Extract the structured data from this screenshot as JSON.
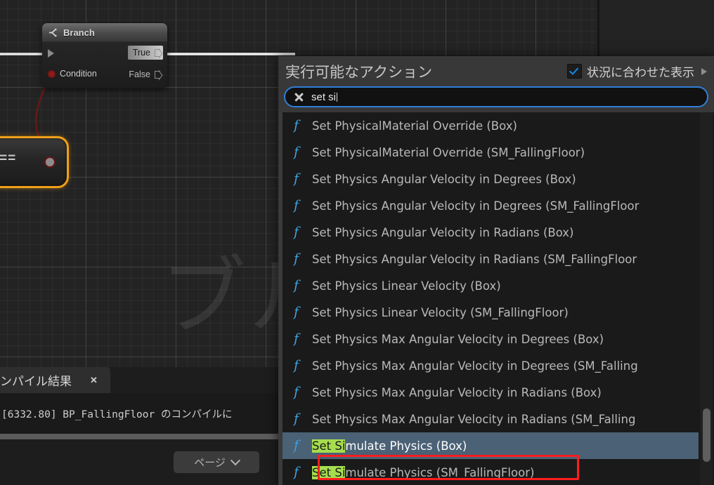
{
  "graph": {
    "watermark": "ブル",
    "branch_node": {
      "title": "Branch",
      "icon": "branch-icon",
      "exec_in": "",
      "condition_label": "Condition",
      "true_label": "True",
      "false_label": "False"
    },
    "equals_node": {
      "label": "==",
      "selected": true
    }
  },
  "actions_menu": {
    "title": "実行可能なアクション",
    "context_checkbox": {
      "label": "状況に合わせた表示",
      "checked": true
    },
    "search": {
      "value": "set si",
      "clear_icon": "close-icon"
    },
    "items": [
      {
        "icon": "function-icon",
        "prefix": "",
        "highlight": "",
        "suffix": "Set PhysicalMaterial Override (Box)",
        "selected": false,
        "annotated": false
      },
      {
        "icon": "function-icon",
        "prefix": "",
        "highlight": "",
        "suffix": "Set PhysicalMaterial Override (SM_FallingFloor)",
        "selected": false,
        "annotated": false
      },
      {
        "icon": "function-icon",
        "prefix": "",
        "highlight": "",
        "suffix": "Set Physics Angular Velocity in Degrees (Box)",
        "selected": false,
        "annotated": false
      },
      {
        "icon": "function-icon",
        "prefix": "",
        "highlight": "",
        "suffix": "Set Physics Angular Velocity in Degrees (SM_FallingFloor",
        "selected": false,
        "annotated": false
      },
      {
        "icon": "function-icon",
        "prefix": "",
        "highlight": "",
        "suffix": "Set Physics Angular Velocity in Radians (Box)",
        "selected": false,
        "annotated": false
      },
      {
        "icon": "function-icon",
        "prefix": "",
        "highlight": "",
        "suffix": "Set Physics Angular Velocity in Radians (SM_FallingFloor",
        "selected": false,
        "annotated": false
      },
      {
        "icon": "function-icon",
        "prefix": "",
        "highlight": "",
        "suffix": "Set Physics Linear Velocity (Box)",
        "selected": false,
        "annotated": false
      },
      {
        "icon": "function-icon",
        "prefix": "",
        "highlight": "",
        "suffix": "Set Physics Linear Velocity (SM_FallingFloor)",
        "selected": false,
        "annotated": false
      },
      {
        "icon": "function-icon",
        "prefix": "",
        "highlight": "",
        "suffix": "Set Physics Max Angular Velocity in Degrees (Box)",
        "selected": false,
        "annotated": false
      },
      {
        "icon": "function-icon",
        "prefix": "",
        "highlight": "",
        "suffix": "Set Physics Max Angular Velocity in Degrees (SM_Falling",
        "selected": false,
        "annotated": false
      },
      {
        "icon": "function-icon",
        "prefix": "",
        "highlight": "",
        "suffix": "Set Physics Max Angular Velocity in Radians (Box)",
        "selected": false,
        "annotated": false
      },
      {
        "icon": "function-icon",
        "prefix": "",
        "highlight": "",
        "suffix": "Set Physics Max Angular Velocity in Radians (SM_Falling",
        "selected": false,
        "annotated": false
      },
      {
        "icon": "function-icon",
        "prefix": "",
        "highlight": "Set Si",
        "suffix": "mulate Physics (Box)",
        "selected": true,
        "annotated": false
      },
      {
        "icon": "function-icon",
        "prefix": "",
        "highlight": "Set Si",
        "suffix": "mulate Physics (SM_FallingFloor)",
        "selected": false,
        "annotated": true
      }
    ]
  },
  "compile_panel": {
    "tab_label": "ンパイル結果",
    "tab_close": "✕",
    "log_line": "[6332.80] BP_FallingFloor のコンパイルに",
    "page_button": "ページ"
  },
  "colors": {
    "accent_blue": "#2f7fd8",
    "selection_blue": "#4a6176",
    "highlight_green": "#a6dd4e",
    "annotation_red": "#ff1d1d",
    "node_selected_orange": "#f0a018",
    "function_icon_blue": "#3e9fe0"
  }
}
